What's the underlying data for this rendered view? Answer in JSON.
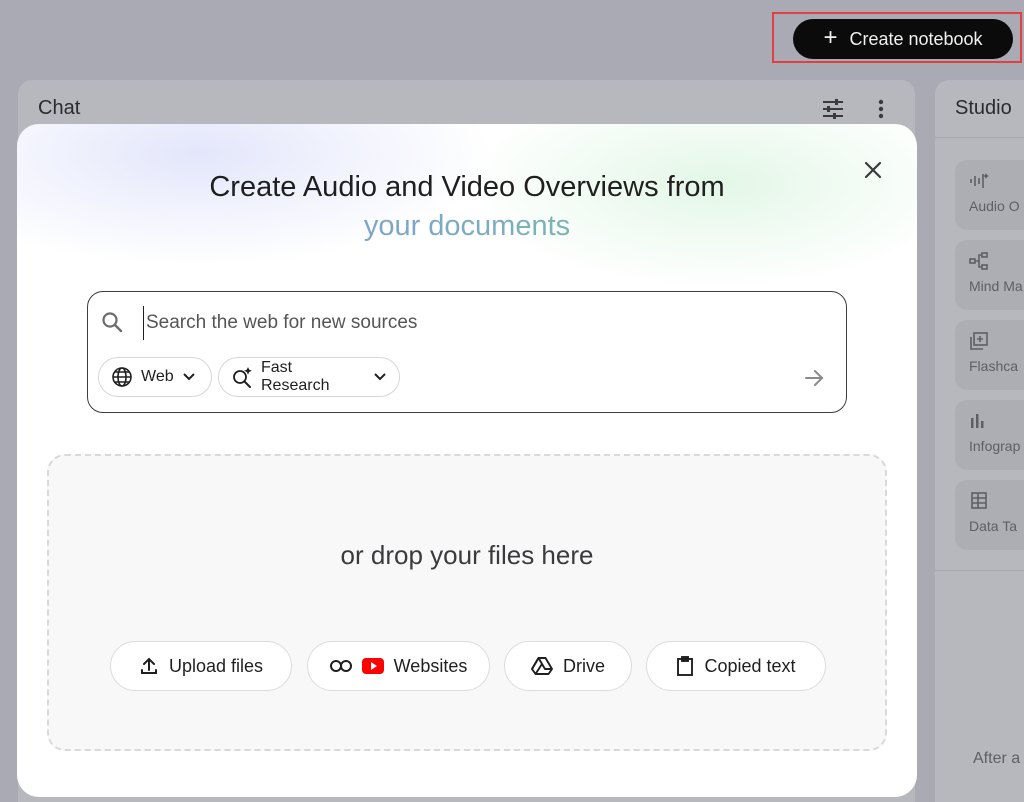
{
  "header": {
    "create_label": "Create notebook"
  },
  "chat": {
    "title": "Chat"
  },
  "studio": {
    "title": "Studio",
    "tiles": [
      {
        "label": "Audio O",
        "icon": "audio-waveform-icon"
      },
      {
        "label": "Mind Ma",
        "icon": "mind-map-icon"
      },
      {
        "label": "Flashca",
        "icon": "flashcards-icon"
      },
      {
        "label": "Infograp",
        "icon": "infographic-icon"
      },
      {
        "label": "Data Ta",
        "icon": "data-table-icon"
      }
    ],
    "after_text": "After a"
  },
  "modal": {
    "title": "Create Audio and Video Overviews from",
    "subtitle": "your documents",
    "search": {
      "placeholder": "Search the web for new sources",
      "source_chip": "Web",
      "mode_chip": "Fast Research"
    },
    "drop_text": "or drop your files here",
    "buttons": {
      "upload": "Upload files",
      "websites": "Websites",
      "drive": "Drive",
      "copied": "Copied text"
    }
  },
  "colors": {
    "create_button_bg": "#0b0b0b",
    "highlight_border": "#e0403f",
    "youtube_red": "#ff0000"
  }
}
